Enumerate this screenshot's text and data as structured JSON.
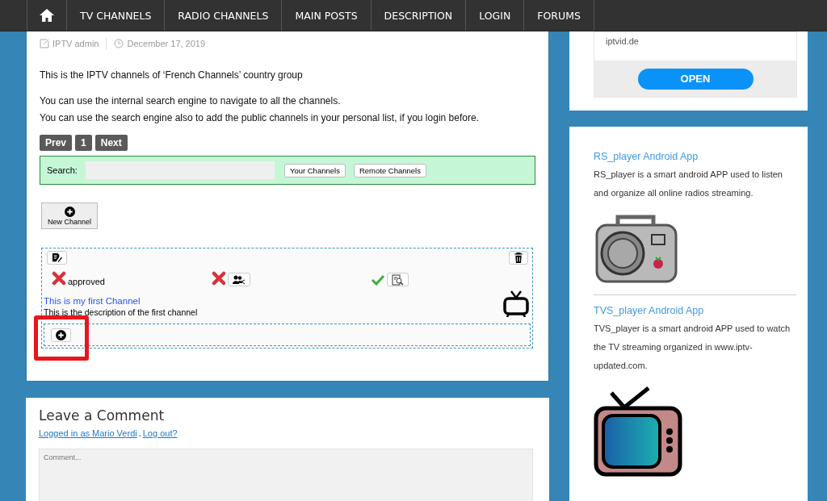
{
  "nav": {
    "items": [
      {
        "label": "TV CHANNELS"
      },
      {
        "label": "RADIO CHANNELS"
      },
      {
        "label": "MAIN POSTS"
      },
      {
        "label": "DESCRIPTION"
      },
      {
        "label": "LOGIN"
      },
      {
        "label": "FORUMS"
      }
    ]
  },
  "post": {
    "author": "IPTV admin",
    "date": "December 17, 2019",
    "paragraphs": [
      [
        "This is the IPTV channels of ‘French Channels’ country group"
      ],
      [
        "You can use the internal search engine to navigate to all the channels.",
        "You can use the search engine also to add the public channels in your personal list, if you login before."
      ]
    ],
    "pagination": [
      {
        "label": "Prev"
      },
      {
        "label": "1"
      },
      {
        "label": "Next"
      }
    ],
    "search": {
      "label": "Search:",
      "buttons": [
        "Your Channels",
        "Remote Channels"
      ]
    },
    "new_channel": "New Channel",
    "channel": {
      "flags": [
        {
          "label": "approved",
          "on": false,
          "kind": "status"
        },
        {
          "on": false,
          "kind": "share"
        },
        {
          "on": true,
          "kind": "review"
        }
      ],
      "title": "This is my first Channel",
      "description": "This is the description of the first channel"
    }
  },
  "comment": {
    "title": "Leave a Comment",
    "logged_in": "Logged in as Mario Verdi",
    "separator": ".",
    "logout": "Log out?",
    "placeholder": "Comment..."
  },
  "sidebar": {
    "ad": {
      "site": "iptvid.de",
      "button": "OPEN"
    },
    "apps": [
      {
        "title": "RS_player Android App",
        "text": "RS_player is a smart android APP used to listen and organize all online radios streaming.",
        "kind": "radio"
      },
      {
        "title": "TVS_player Android App",
        "text": "TVS_player is a smart android APP used to watch the TV streaming organized in www.iptv-updated.com.",
        "kind": "tv"
      }
    ]
  }
}
